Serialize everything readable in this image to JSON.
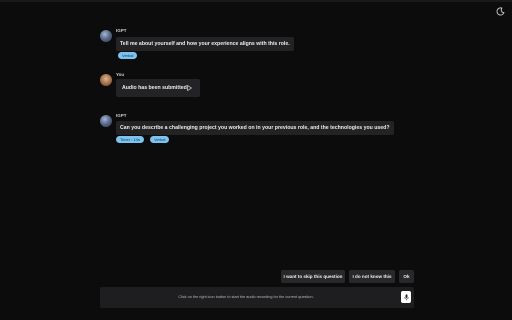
{
  "header": {
    "theme_icon": "moon-icon"
  },
  "messages": [
    {
      "sender": "IGPT",
      "text": "Tell me about yourself and how your experience aligns with this role.",
      "badges": [
        "Verbal"
      ]
    },
    {
      "sender": "You",
      "audio_label": "Audio has been submitted",
      "play_icon": "play-icon"
    },
    {
      "sender": "IGPT",
      "text": "Can you describe a challenging project you worked on in your previous role, and the technologies you used?",
      "badges": [
        "Timer : 14s",
        "Verbal"
      ]
    }
  ],
  "actions": {
    "skip_label": "I want to skip this question",
    "dont_know_label": "I do not know this",
    "ok_label": "Ok"
  },
  "composer": {
    "hint": "Click on the right icon button to start the audio recording for the current question.",
    "mic_icon": "microphone-icon"
  },
  "colors": {
    "background": "#0c0c0d",
    "bubble": "#232325",
    "badge": "#7cc3ef",
    "button": "#28282a"
  }
}
